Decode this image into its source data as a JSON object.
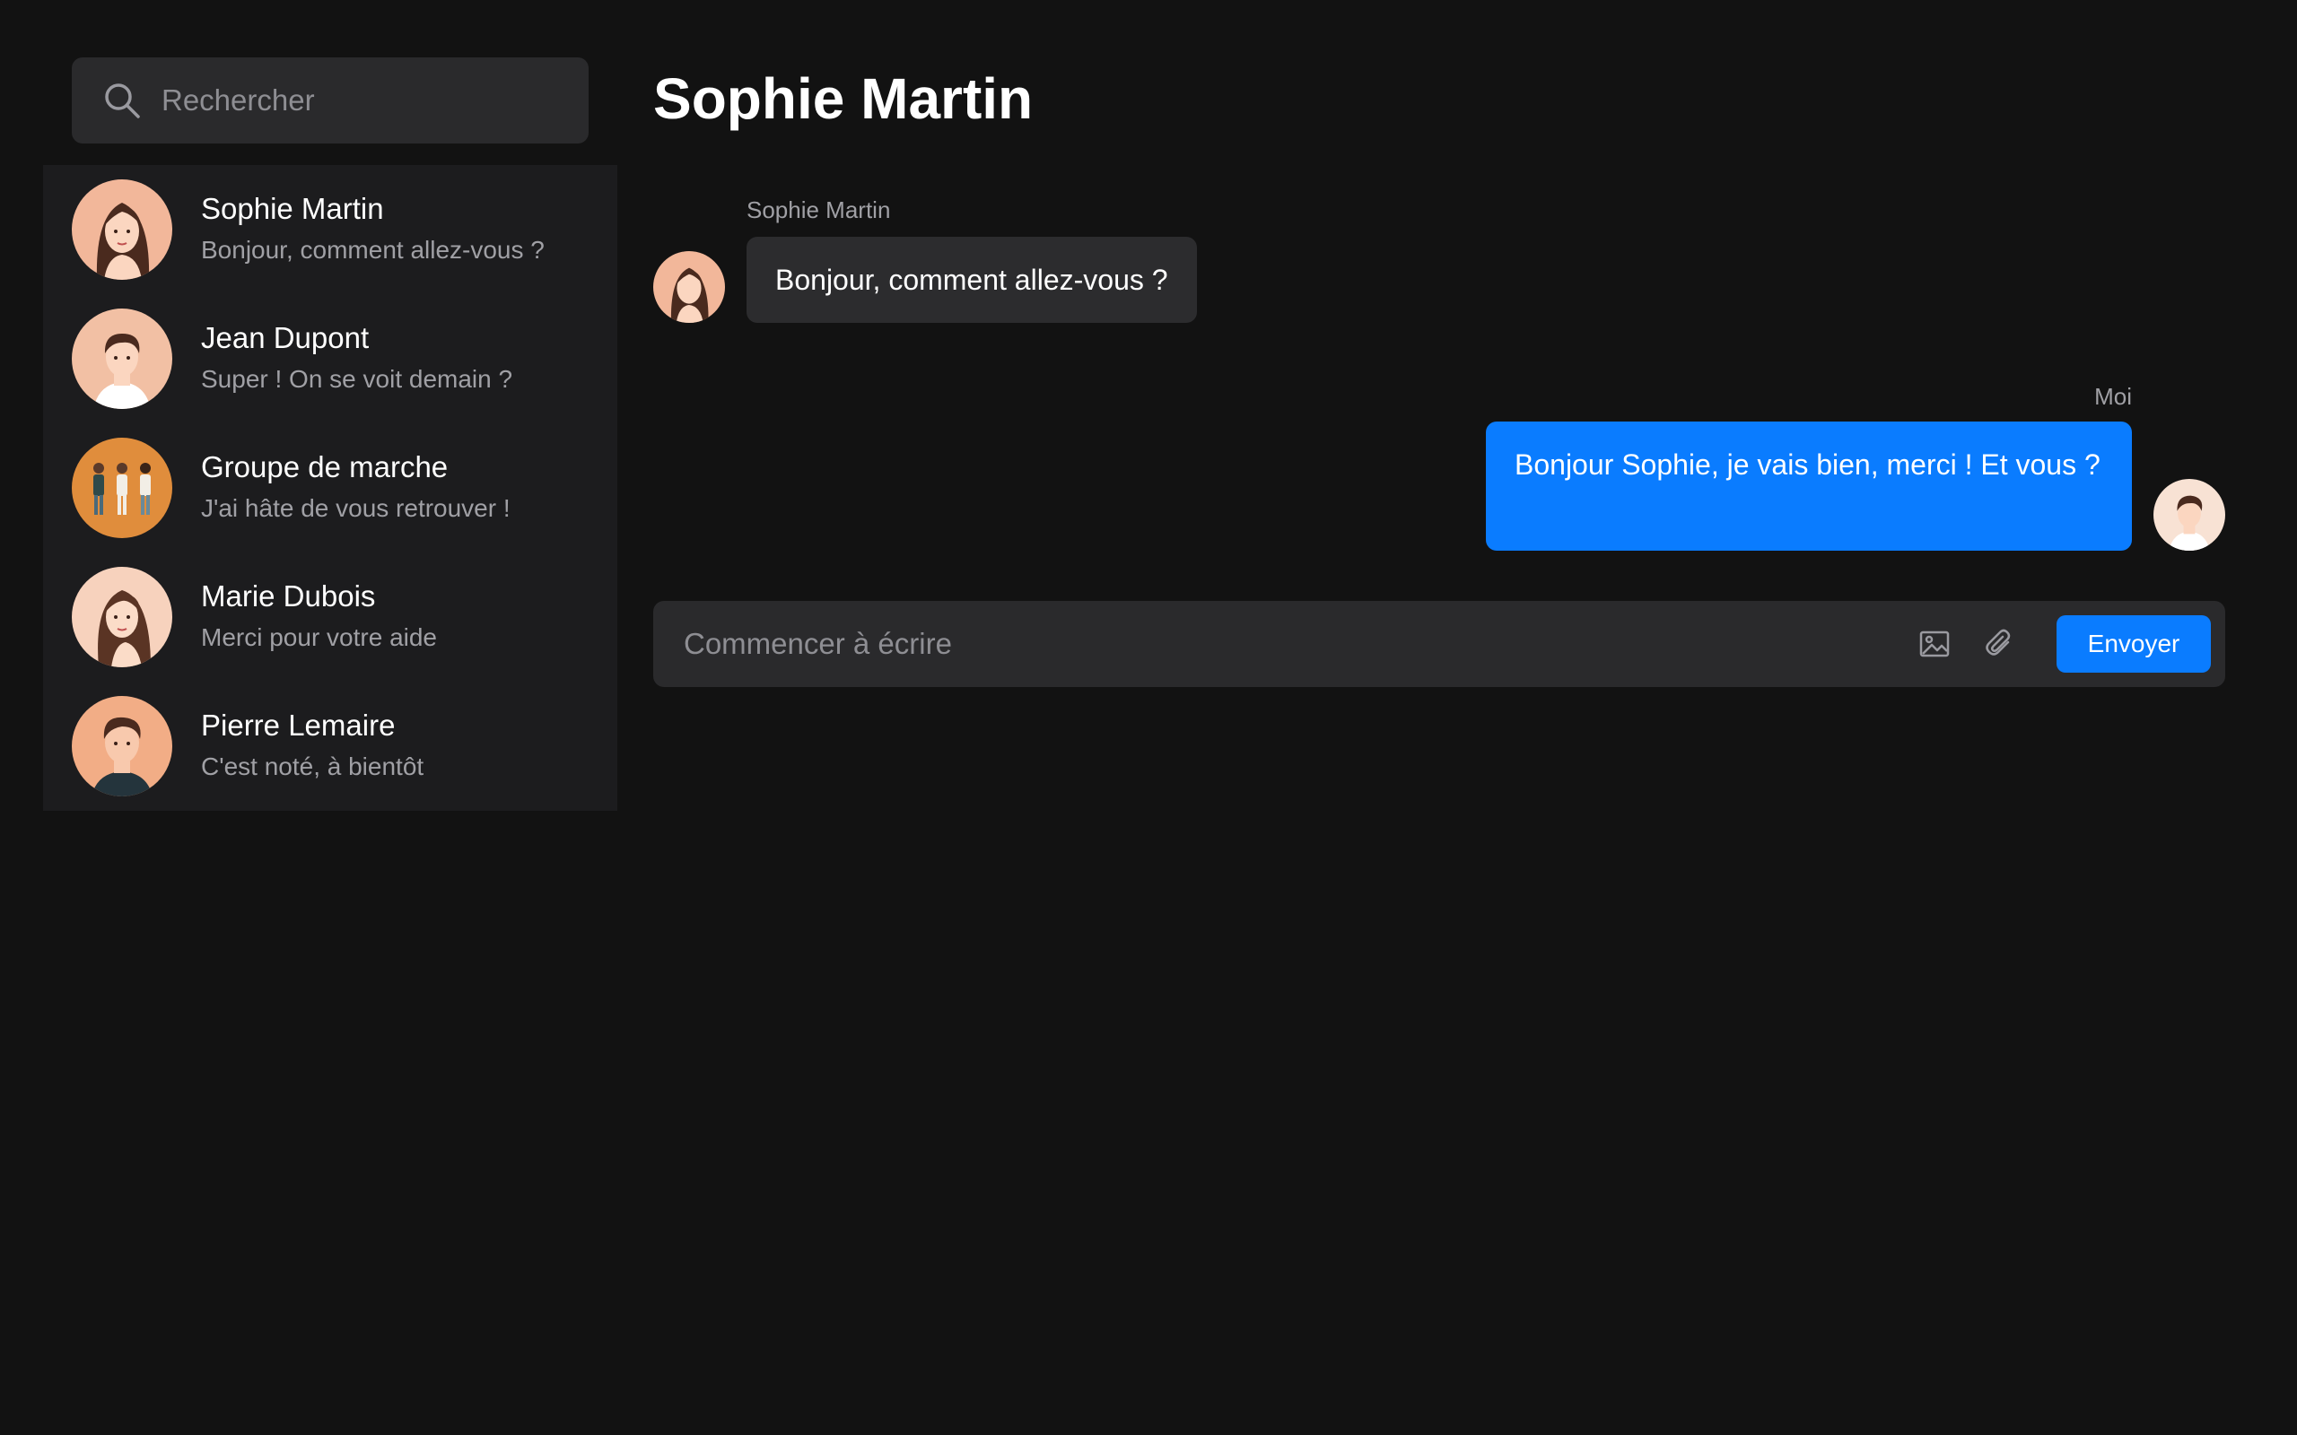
{
  "colors": {
    "background": "#121212",
    "panel": "#1c1c1e",
    "field": "#2a2a2c",
    "incoming_bubble": "#2c2c2e",
    "accent": "#0a7cff",
    "muted_text": "#a0a0a5"
  },
  "search": {
    "placeholder": "Rechercher",
    "icon": "search-icon"
  },
  "conversations": [
    {
      "name": "Sophie Martin",
      "preview": "Bonjour, comment allez-vous ?",
      "avatar": "woman-portrait"
    },
    {
      "name": "Jean Dupont",
      "preview": "Super ! On se voit demain ?",
      "avatar": "man-portrait"
    },
    {
      "name": "Groupe de marche",
      "preview": "J'ai hâte de vous retrouver !",
      "avatar": "group-portrait"
    },
    {
      "name": "Marie Dubois",
      "preview": "Merci pour votre aide",
      "avatar": "woman-portrait"
    },
    {
      "name": "Pierre Lemaire",
      "preview": "C'est noté, à bientôt",
      "avatar": "man-portrait"
    }
  ],
  "chat": {
    "title": "Sophie Martin",
    "messages": [
      {
        "sender": "Sophie Martin",
        "text": "Bonjour, comment allez-vous ?",
        "direction": "incoming"
      },
      {
        "sender": "Moi",
        "text": "Bonjour Sophie, je vais bien, merci ! Et vous ?",
        "direction": "outgoing"
      }
    ]
  },
  "composer": {
    "placeholder": "Commencer à écrire",
    "image_icon": "image-icon",
    "attach_icon": "paperclip-icon",
    "send_label": "Envoyer"
  }
}
